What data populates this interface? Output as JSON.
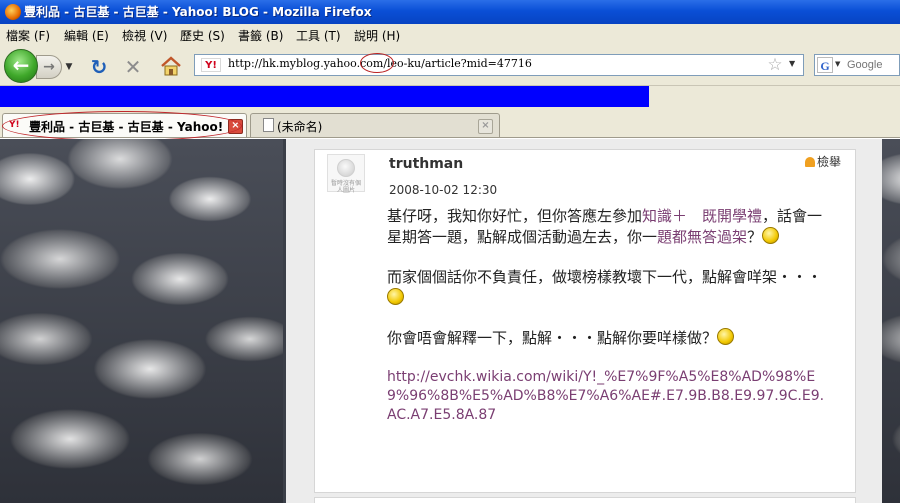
{
  "window": {
    "title": "豐利品 - 古巨基 - 古巨基 - Yahoo! BLOG - Mozilla Firefox"
  },
  "menu": {
    "items": [
      "檔案 (F)",
      "編輯 (E)",
      "檢視 (V)",
      "歷史 (S)",
      "書籤 (B)",
      "工具 (T)",
      "說明 (H)"
    ]
  },
  "toolbar": {
    "back": "←",
    "forward": "→",
    "reload": "↻",
    "stop": "✕",
    "url": "http://hk.myblog.yahoo.com/leo-ku/article?mid=47716",
    "site_icon": "Y!",
    "search_engine": "G",
    "search_placeholder": "Google"
  },
  "tabs": [
    {
      "label": "豐利品 - 古巨基 - 古巨基 - Yahoo! BLOG",
      "active": true,
      "icon": "Y!"
    },
    {
      "label": "(未命名)",
      "active": false
    }
  ],
  "comment": {
    "author": "truthman",
    "date": "2008-10-02 12:30",
    "report": "檢舉",
    "avatar_caption": "暫時沒有個人圖片",
    "p1_a": "基仔呀，我知你好忙，但你答應左參加",
    "p1_link": "知識＋　既開學禮",
    "p1_b": "，話會一星期答一題，點解成個活動過左去，你一",
    "p1_link2": "題都無答過架",
    "p1_c": "？",
    "p2": "而家個個話你不負責任，做壞榜樣教壞下一代，點解會咩架・・・",
    "p3": "你會唔會解釋一下，點解・・・點解你要咩樣做？",
    "url": "http://evchk.wikia.com/wiki/Y!_%E7%9F%A5%E8%AD%98%E9%96%8B%E5%AD%B8%E7%A6%AE#.E7.9B.B8.E9.97.9C.E9.AC.A7.E5.8A.87"
  },
  "colors": {
    "titlebar": "#0a4fd6",
    "bluebar": "#0000ff",
    "link": "#7a3e72",
    "chrome": "#ece9d8"
  }
}
